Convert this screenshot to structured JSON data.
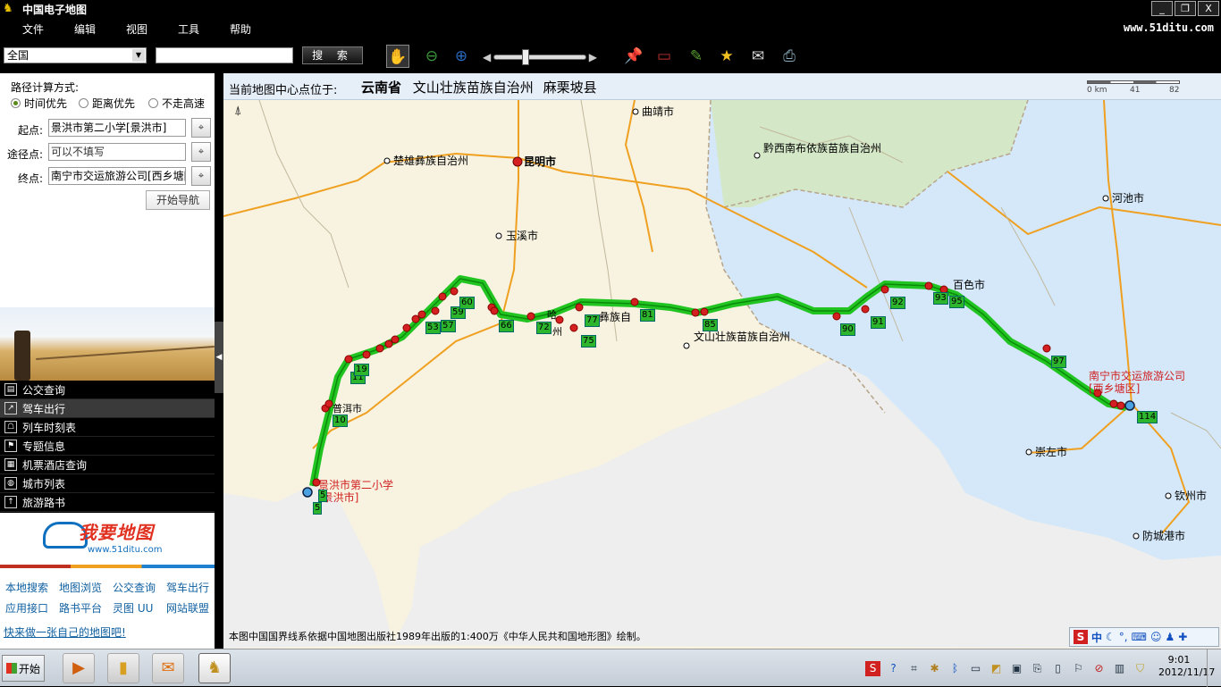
{
  "window": {
    "title": "中国电子地图",
    "btn_min": "_",
    "btn_max": "❐",
    "btn_close": "X"
  },
  "menu": {
    "items": [
      "文件",
      "编辑",
      "视图",
      "工具",
      "帮助"
    ],
    "site_url": "www.51ditu.com"
  },
  "toolbar": {
    "region": "全国",
    "search_value": "",
    "search_label": "搜 索"
  },
  "route": {
    "title": "路径计算方式:",
    "options": [
      {
        "label": "时间优先",
        "selected": true
      },
      {
        "label": "距离优先",
        "selected": false
      },
      {
        "label": "不走高速",
        "selected": false
      }
    ],
    "start_label": "起点:",
    "start_value": "景洪市第二小学[景洪市]",
    "via_label": "途径点:",
    "via_value": "可以不填写",
    "end_label": "终点:",
    "end_value": "南宁市交运旅游公司[西乡塘[",
    "nav_button": "开始导航"
  },
  "functions": [
    "公交查询",
    "驾车出行",
    "列车时刻表",
    "专题信息",
    "机票酒店查询",
    "城市列表",
    "旅游路书"
  ],
  "functions_active": "驾车出行",
  "logo": {
    "text_a": "我要",
    "text_b": "地图",
    "url": "www.51ditu.com"
  },
  "links": [
    [
      "本地搜索",
      "地图浏览",
      "公交查询",
      "驾车出行"
    ],
    [
      "应用接口",
      "路书平台",
      "灵图 UU",
      "网站联盟"
    ]
  ],
  "make_map": "快来做一张自己的地图吧!",
  "map": {
    "center_label": "当前地图中心点位于:",
    "center_province": "云南省",
    "center_prefecture": "文山壮族苗族自治州",
    "center_county": "麻栗坡县",
    "scale_labels": [
      "0 km",
      "41",
      "82"
    ],
    "copyright": "本图中国国界线系依据中国地图出版社1989年出版的1:400万《中华人民共和国地形图》绘制。",
    "places": [
      {
        "name": "曲靖市",
        "kind": "city"
      },
      {
        "name": "昆明市",
        "kind": "capital"
      },
      {
        "name": "楚雄彝族自治州",
        "kind": "city"
      },
      {
        "name": "黔西南布依族苗族自治州",
        "kind": "city"
      },
      {
        "name": "玉溪市",
        "kind": "city"
      },
      {
        "name": "河池市",
        "kind": "city"
      },
      {
        "name": "百色市",
        "kind": "city"
      },
      {
        "name": "文山壮族苗族自治州",
        "kind": "city"
      },
      {
        "name": "普洱市",
        "kind": "city"
      },
      {
        "name": "崇左市",
        "kind": "city"
      },
      {
        "name": "钦州市",
        "kind": "city"
      },
      {
        "name": "防城港市",
        "kind": "city"
      },
      {
        "name": "南宁市交运旅游公司[西乡塘区]",
        "kind": "red"
      },
      {
        "name": "景洪市第二小学[景洪市]",
        "kind": "red"
      }
    ],
    "route_labels": [
      "5",
      "5",
      "10",
      "11",
      "19",
      "53",
      "57",
      "59",
      "60",
      "66",
      "72",
      "75",
      "77",
      "81",
      "85",
      "90",
      "91",
      "92",
      "93",
      "95",
      "97",
      "114"
    ],
    "partial_labels": [
      "哈",
      "州",
      "彝族自"
    ]
  },
  "taskbar": {
    "start": "开始",
    "time": "9:01",
    "date": "2012/11/17"
  },
  "ime": {
    "s": "S",
    "zh": "中"
  }
}
